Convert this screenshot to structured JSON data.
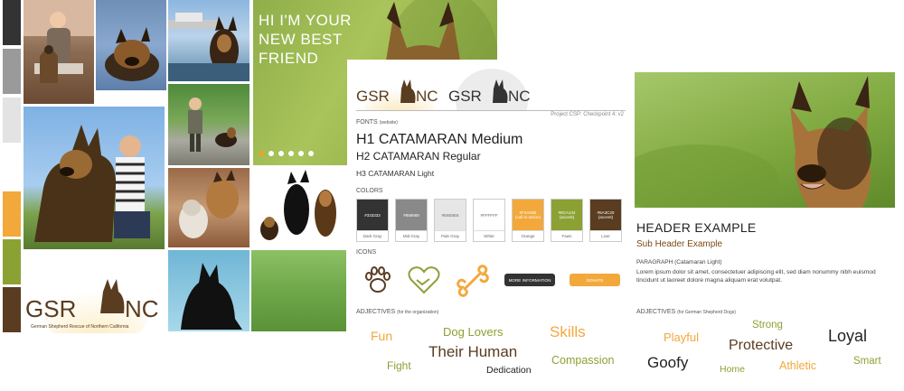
{
  "hero": {
    "title": "HI I'M YOUR NEW BEST FRIEND",
    "carousel_dots": 6,
    "active_dot": 0
  },
  "brand": {
    "logo_text": "GSR NC",
    "logo_tagline": "German Shepherd Rescue of Northern California"
  },
  "style_guide": {
    "project": "Project CSP: Checkpoint 4: v2",
    "fonts_label": "FONTS",
    "fonts_note": "(website)",
    "h1": "H1 CATAMARAN Medium",
    "h2": "H2 CATAMARAN Regular",
    "h3": "H3 CATAMARAN Light",
    "colors_label": "COLORS",
    "colors": [
      {
        "hex": "#333333",
        "name": "Dark Gray",
        "note": ""
      },
      {
        "hex": "#898989",
        "name": "Mid Gray",
        "note": ""
      },
      {
        "hex": "#E6E6E6",
        "name": "Pale Gray",
        "note": ""
      },
      {
        "hex": "#FFFFFF",
        "name": "White",
        "note": ""
      },
      {
        "hex": "#F3A83B",
        "name": "Orange",
        "note": "(call to action)"
      },
      {
        "hex": "#8CA134",
        "name": "Fawn",
        "note": "(accent)"
      },
      {
        "hex": "#5A3C20",
        "name": "Liver",
        "note": "(accent)"
      }
    ],
    "icons_label": "ICONS",
    "icons": [
      "paw-icon",
      "heart-handshake-icon",
      "bone-icon"
    ],
    "more_info_button": "MORE INFORMATION",
    "donate_button": "DONATE",
    "adjectives_label": "ADJECTIVES",
    "adjectives_note": "(for the organization)",
    "adjectives": [
      "Fun",
      "Dog Lovers",
      "Skills",
      "Their Human",
      "Fight",
      "Compassion",
      "Dedication"
    ]
  },
  "right_panel": {
    "header": "HEADER EXAMPLE",
    "subheader": "Sub Header Example",
    "paragraph_label": "PARAGRAPH (Catamaran Light)",
    "paragraph": "Lorem ipsum dolor sit amet, consectetuer adipiscing elit, sed diam nonummy nibh euismod tincidunt ut laoreet dolore magna aliquam erat volutpat.",
    "adjectives_label": "ADJECTIVES",
    "adjectives_note": "(for German Shepherd Dogs)",
    "adjectives": [
      "Strong",
      "Playful",
      "Protective",
      "Loyal",
      "Goofy",
      "Home",
      "Athletic",
      "Smart"
    ]
  },
  "colors": {
    "orange": "#F3A83B",
    "fawn": "#8CA134",
    "liver": "#5A3C20",
    "dark_gray": "#333333"
  }
}
